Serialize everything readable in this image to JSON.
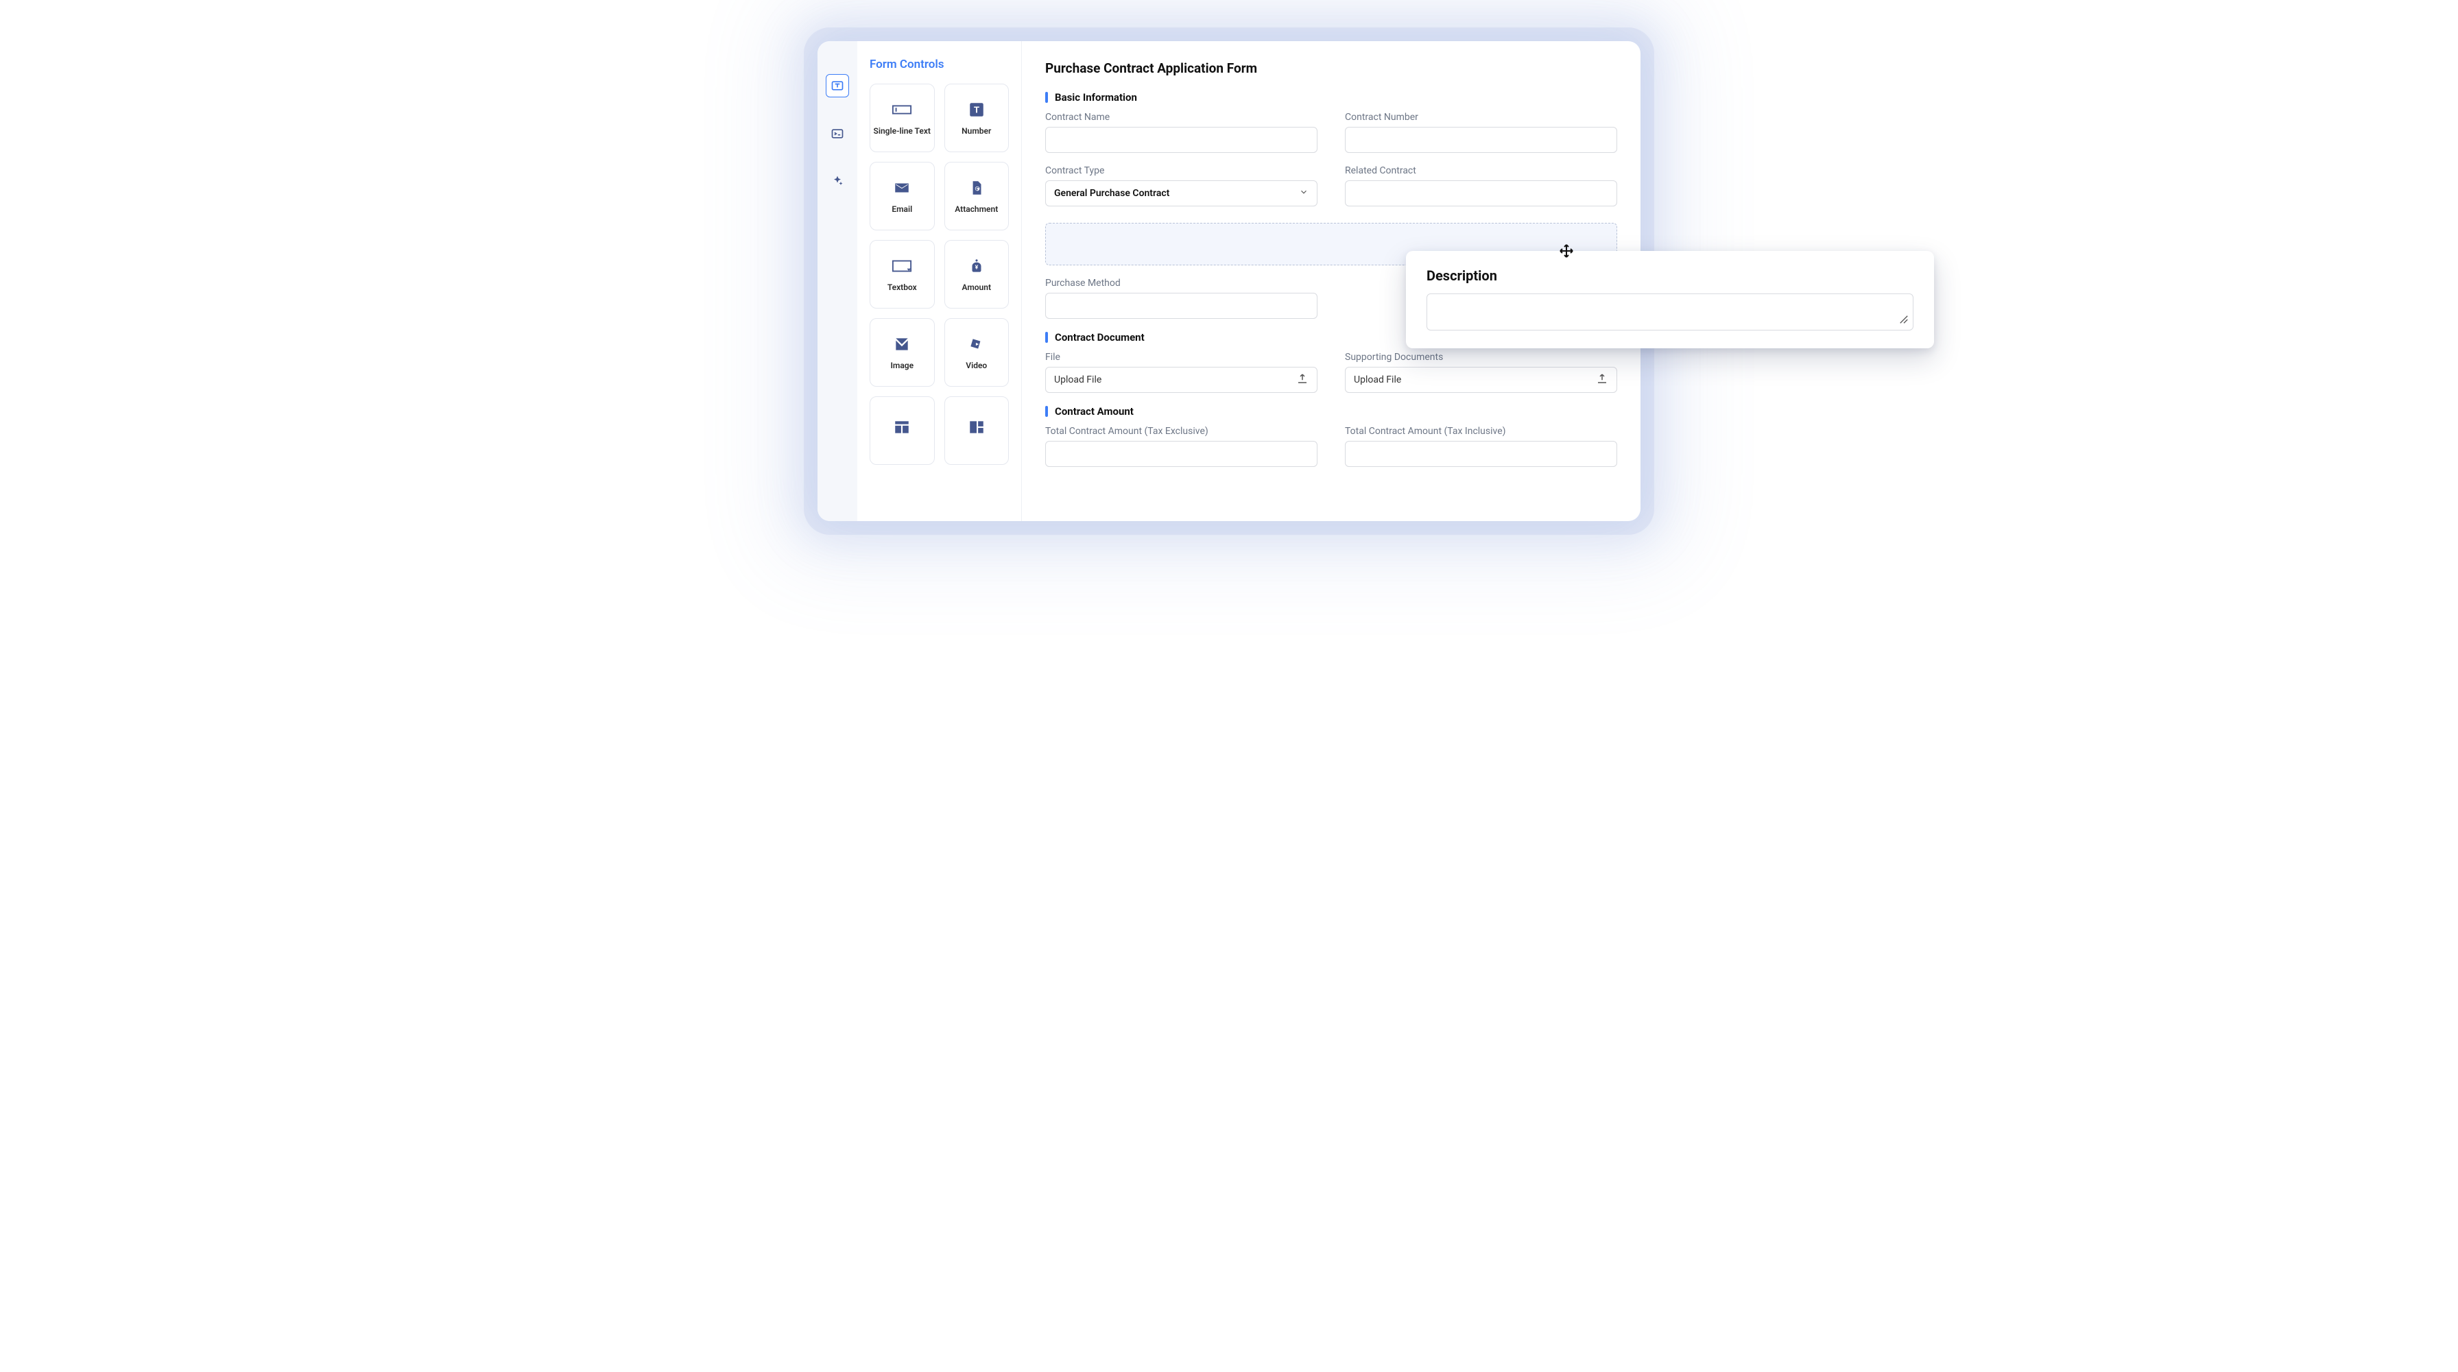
{
  "panel": {
    "title": "Form Controls",
    "controls": [
      "Single-line Text",
      "Number",
      "Email",
      "Attachment",
      "Textbox",
      "Amount",
      "Image",
      "Video",
      "",
      ""
    ]
  },
  "form": {
    "title": "Purchase Contract Application Form",
    "sections": {
      "basic": {
        "title": "Basic Information",
        "fields": {
          "contract_name": "Contract Name",
          "contract_number": "Contract Number",
          "contract_type": "Contract Type",
          "contract_type_value": "General Purchase Contract",
          "related_contract": "Related Contract",
          "purchase_method": "Purchase Method"
        }
      },
      "document": {
        "title": "Contract Document",
        "fields": {
          "file": "File",
          "file_placeholder": "Upload File",
          "supporting": "Supporting Documents",
          "supporting_placeholder": "Upload File"
        }
      },
      "amount": {
        "title": "Contract Amount",
        "fields": {
          "total_ex": "Total Contract Amount (Tax Exclusive)",
          "total_inc": "Total Contract Amount (Tax Inclusive)"
        }
      }
    }
  },
  "floating": {
    "title": "Description"
  }
}
